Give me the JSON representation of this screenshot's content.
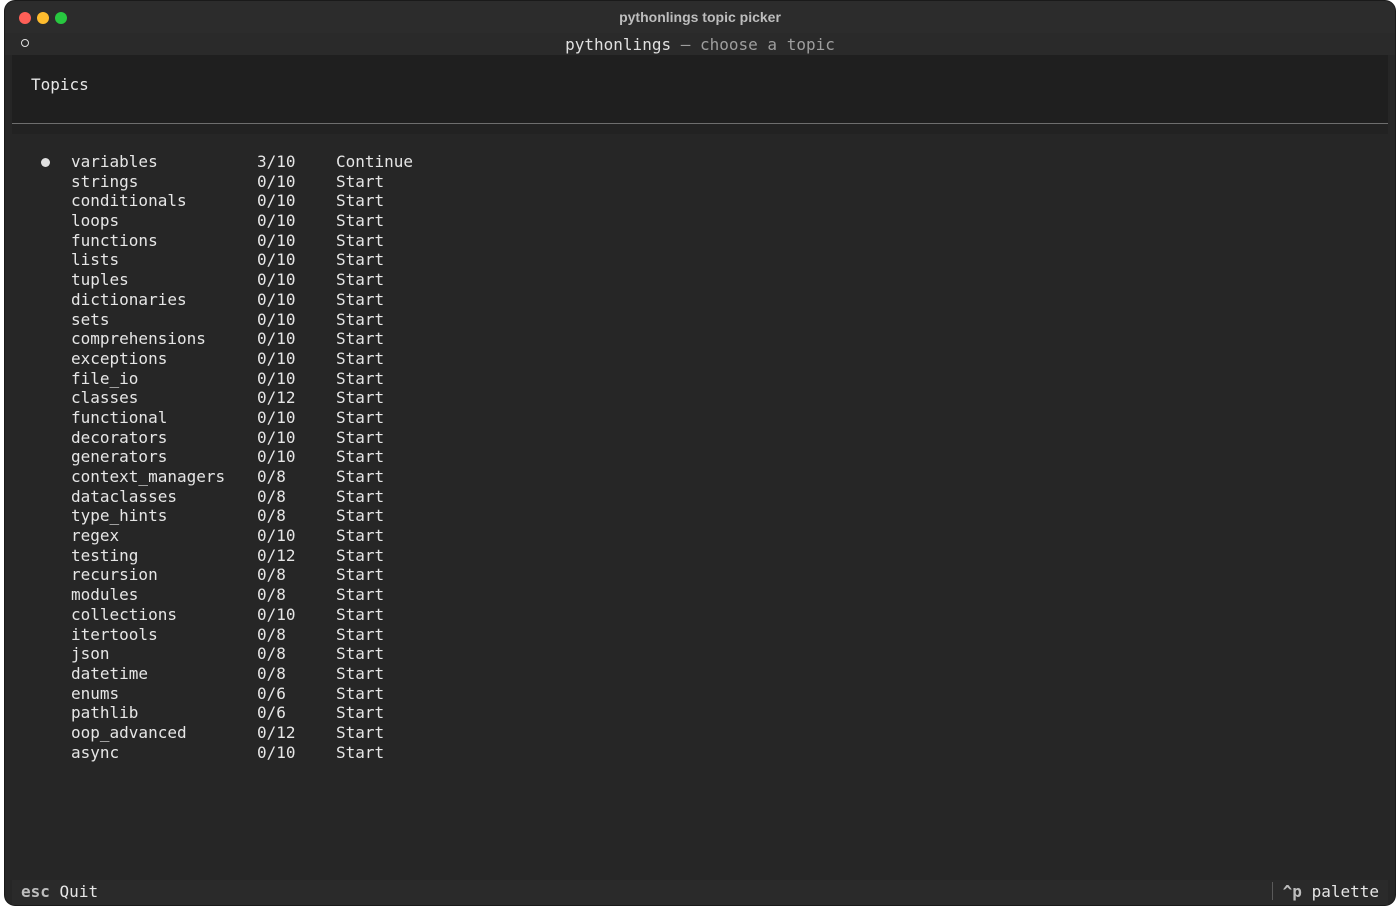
{
  "window": {
    "title": "pythonlings topic picker"
  },
  "header": {
    "app_name": "pythonlings",
    "separator": " — ",
    "subtitle": "choose a topic"
  },
  "panel": {
    "heading": "Topics"
  },
  "topics": [
    {
      "name": "variables",
      "progress": "3/10",
      "action": "Continue",
      "selected": true
    },
    {
      "name": "strings",
      "progress": "0/10",
      "action": "Start"
    },
    {
      "name": "conditionals",
      "progress": "0/10",
      "action": "Start"
    },
    {
      "name": "loops",
      "progress": "0/10",
      "action": "Start"
    },
    {
      "name": "functions",
      "progress": "0/10",
      "action": "Start"
    },
    {
      "name": "lists",
      "progress": "0/10",
      "action": "Start"
    },
    {
      "name": "tuples",
      "progress": "0/10",
      "action": "Start"
    },
    {
      "name": "dictionaries",
      "progress": "0/10",
      "action": "Start"
    },
    {
      "name": "sets",
      "progress": "0/10",
      "action": "Start"
    },
    {
      "name": "comprehensions",
      "progress": "0/10",
      "action": "Start"
    },
    {
      "name": "exceptions",
      "progress": "0/10",
      "action": "Start"
    },
    {
      "name": "file_io",
      "progress": "0/10",
      "action": "Start"
    },
    {
      "name": "classes",
      "progress": "0/12",
      "action": "Start"
    },
    {
      "name": "functional",
      "progress": "0/10",
      "action": "Start"
    },
    {
      "name": "decorators",
      "progress": "0/10",
      "action": "Start"
    },
    {
      "name": "generators",
      "progress": "0/10",
      "action": "Start"
    },
    {
      "name": "context_managers",
      "progress": "0/8",
      "action": "Start"
    },
    {
      "name": "dataclasses",
      "progress": "0/8",
      "action": "Start"
    },
    {
      "name": "type_hints",
      "progress": "0/8",
      "action": "Start"
    },
    {
      "name": "regex",
      "progress": "0/10",
      "action": "Start"
    },
    {
      "name": "testing",
      "progress": "0/12",
      "action": "Start"
    },
    {
      "name": "recursion",
      "progress": "0/8",
      "action": "Start"
    },
    {
      "name": "modules",
      "progress": "0/8",
      "action": "Start"
    },
    {
      "name": "collections",
      "progress": "0/10",
      "action": "Start"
    },
    {
      "name": "itertools",
      "progress": "0/8",
      "action": "Start"
    },
    {
      "name": "json",
      "progress": "0/8",
      "action": "Start"
    },
    {
      "name": "datetime",
      "progress": "0/8",
      "action": "Start"
    },
    {
      "name": "enums",
      "progress": "0/6",
      "action": "Start"
    },
    {
      "name": "pathlib",
      "progress": "0/6",
      "action": "Start"
    },
    {
      "name": "oop_advanced",
      "progress": "0/12",
      "action": "Start"
    },
    {
      "name": "async",
      "progress": "0/10",
      "action": "Start"
    }
  ],
  "footer": {
    "quit_key": "esc",
    "quit_label": "Quit",
    "palette_key": "^p",
    "palette_label": "palette"
  },
  "colors": {
    "background": "#262626",
    "text": "#e6e6e6",
    "muted": "#9e9e9e",
    "close": "#fe5f57",
    "minimize": "#febc2e",
    "maximize": "#28c840"
  },
  "icons": {
    "header_icon": "circle-outline-icon",
    "selected_marker": "bullet-icon"
  }
}
